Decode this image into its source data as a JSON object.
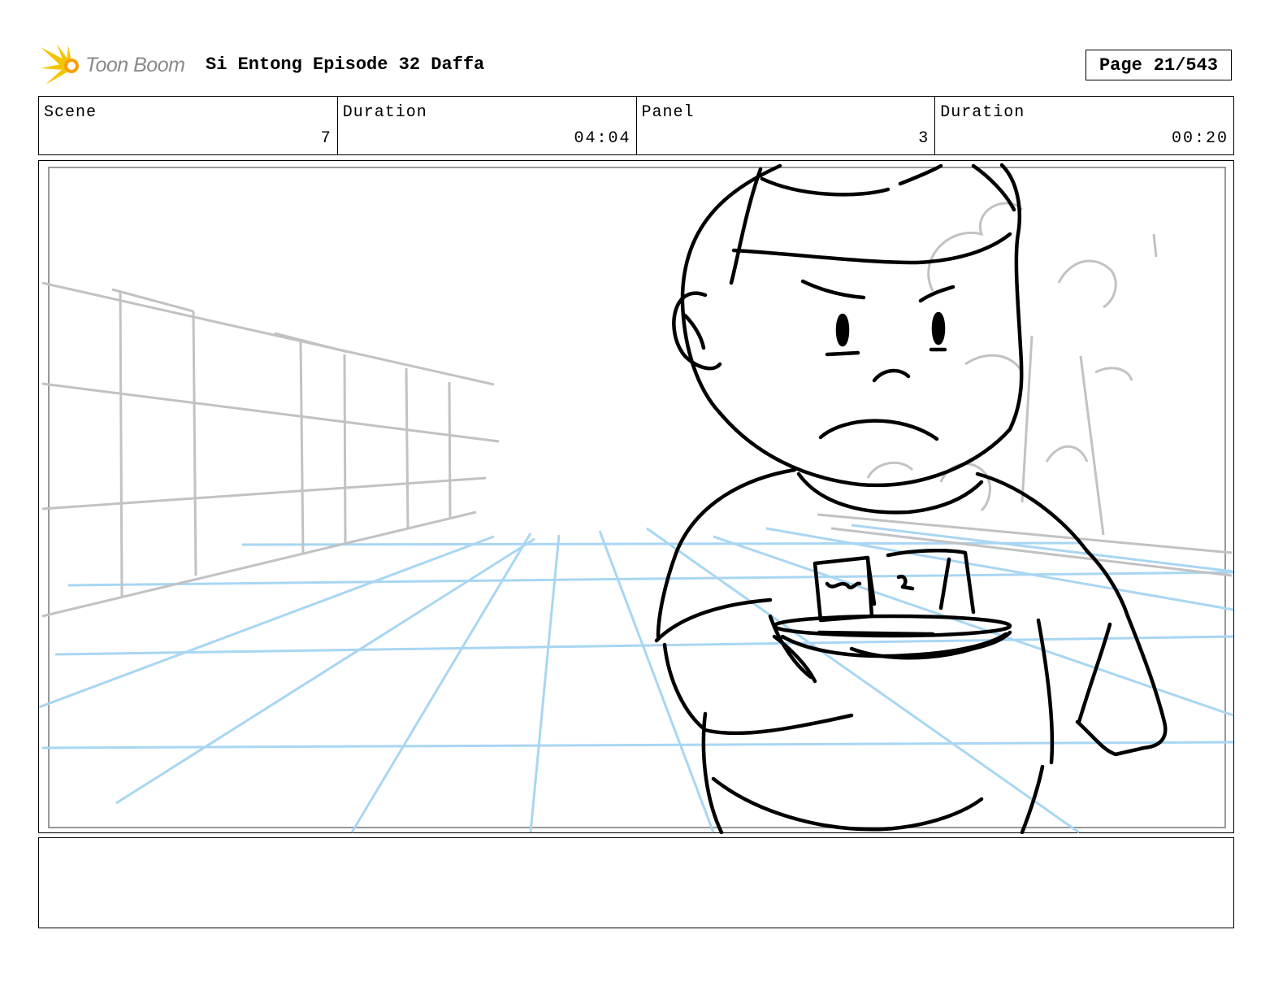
{
  "header": {
    "logo_text": "Toon Boom",
    "logo_icon": "toon-boom-burst-icon",
    "title": "Si Entong Episode 32 Daffa",
    "page_label": "Page",
    "page_value": "21/543"
  },
  "info": {
    "scene_label": "Scene",
    "scene_value": "7",
    "scene_duration_label": "Duration",
    "scene_duration_value": "04:04",
    "panel_label": "Panel",
    "panel_value": "3",
    "panel_duration_label": "Duration",
    "panel_duration_value": "00:20"
  },
  "colors": {
    "logo_yellow": "#f5c400",
    "perspective_grid": "#a9d6f2",
    "background_sketch": "#c2c2c2",
    "character_ink": "#000000"
  },
  "notes": ""
}
